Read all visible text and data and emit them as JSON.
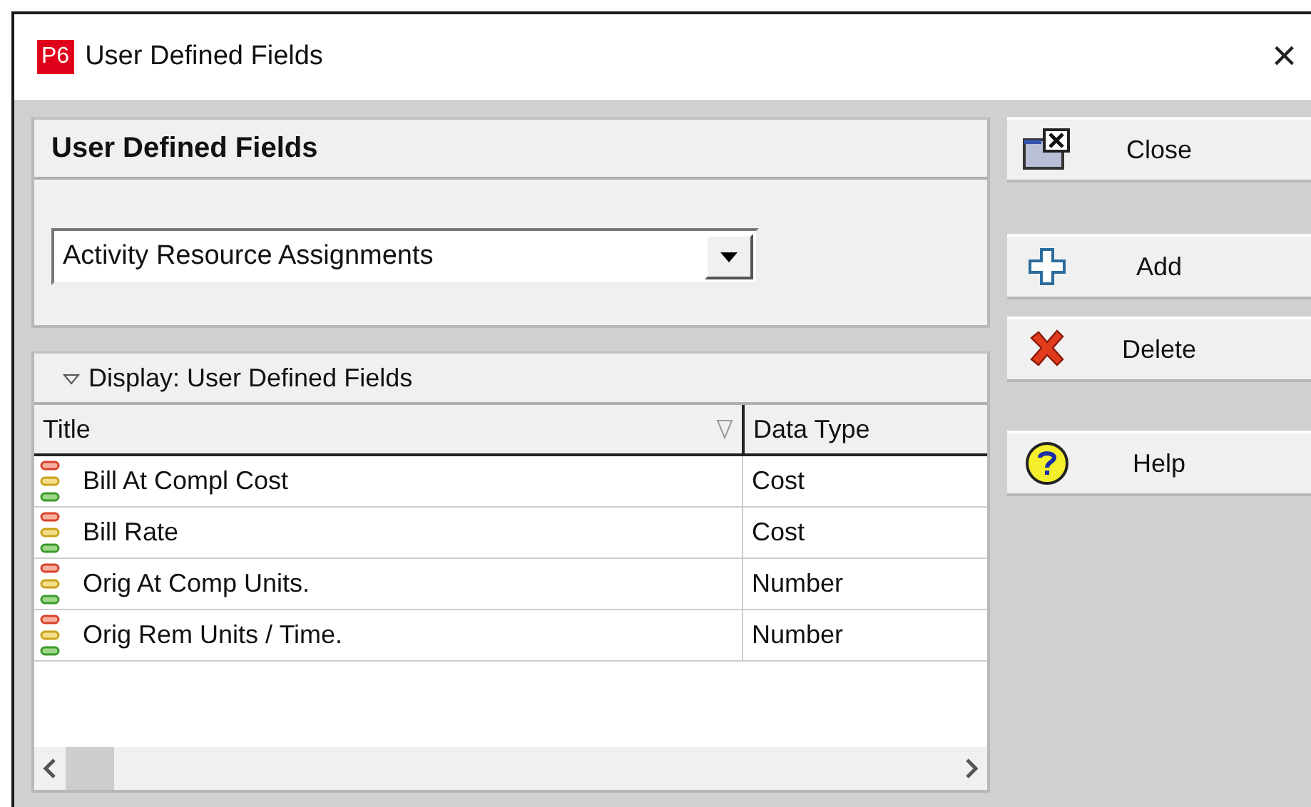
{
  "window": {
    "logo": "P6",
    "title": "User Defined Fields",
    "close": "×"
  },
  "category_panel": {
    "heading": "User Defined Fields",
    "dropdown": {
      "value": "Activity Resource Assignments"
    }
  },
  "display_panel": {
    "heading": "Display: User Defined Fields",
    "expanded": true,
    "columns": [
      "Title",
      "Data Type"
    ],
    "rows": [
      {
        "title": "Bill At Compl Cost",
        "data_type": "Cost"
      },
      {
        "title": "Bill Rate",
        "data_type": "Cost"
      },
      {
        "title": "Orig At Comp Units.",
        "data_type": "Number"
      },
      {
        "title": "Orig Rem Units / Time.",
        "data_type": "Number"
      }
    ]
  },
  "buttons": [
    {
      "kind": "close",
      "label": "Close"
    },
    {
      "kind": "add",
      "label": "Add"
    },
    {
      "kind": "delete",
      "label": "Delete"
    },
    {
      "kind": "help",
      "label": "Help"
    }
  ]
}
